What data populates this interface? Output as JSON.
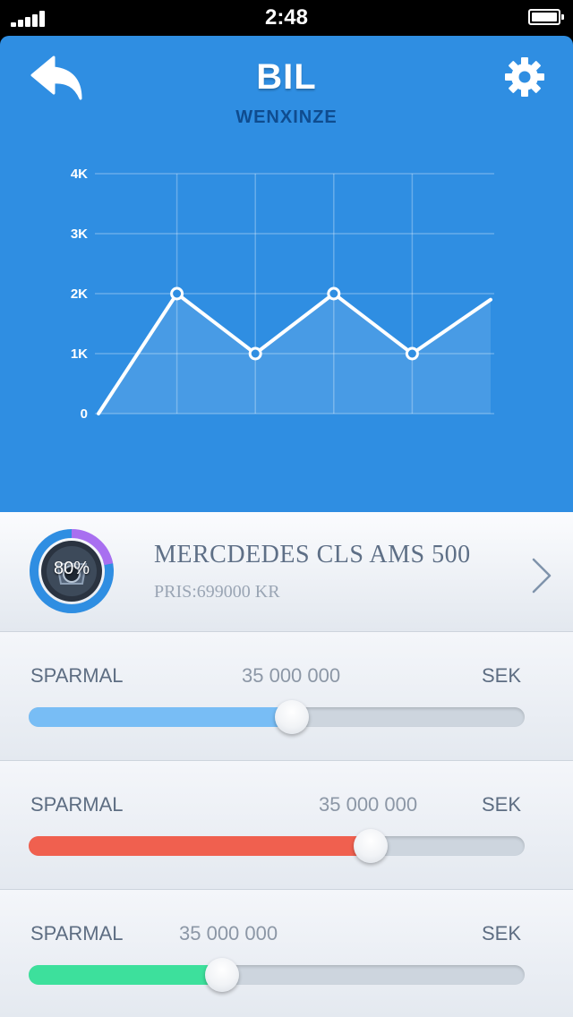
{
  "status_bar": {
    "time": "2:48"
  },
  "header": {
    "title": "BIL",
    "subtitle": "WENXINZE",
    "back_icon": "back-arrow-icon",
    "settings_icon": "gear-icon"
  },
  "chart_data": {
    "type": "line",
    "x": [
      0,
      1,
      2,
      3,
      4,
      5
    ],
    "series": [
      {
        "values": [
          0,
          2000,
          1000,
          2000,
          1000,
          1900
        ]
      }
    ],
    "marked_points": [
      1,
      2,
      3,
      4
    ],
    "y_ticks": [
      "0",
      "1K",
      "2K",
      "3K",
      "4K"
    ],
    "ylim": [
      0,
      4000
    ],
    "grid": true
  },
  "car": {
    "name": "MERCDEDES CLS AMS 500",
    "price": "PRIS:699000 KR",
    "progress_label": "80%",
    "progress": 0.8
  },
  "sliders": [
    {
      "label": "SPARMAL",
      "amount": "35 000 000",
      "unit": "SEK",
      "value": 0.53,
      "color": "#78bdf5"
    },
    {
      "label": "SPARMAL",
      "amount": "35 000 000",
      "unit": "SEK",
      "value": 0.69,
      "color": "#f0604f"
    },
    {
      "label": "SPARMAL",
      "amount": "35 000 000",
      "unit": "SEK",
      "value": 0.39,
      "color": "#3de09c"
    }
  ],
  "colors": {
    "header_bg": "#2f8ee2",
    "subtitle": "#0f4c8f",
    "ring_blue": "#2f8ee2",
    "ring_purple": "#a86ff0"
  }
}
